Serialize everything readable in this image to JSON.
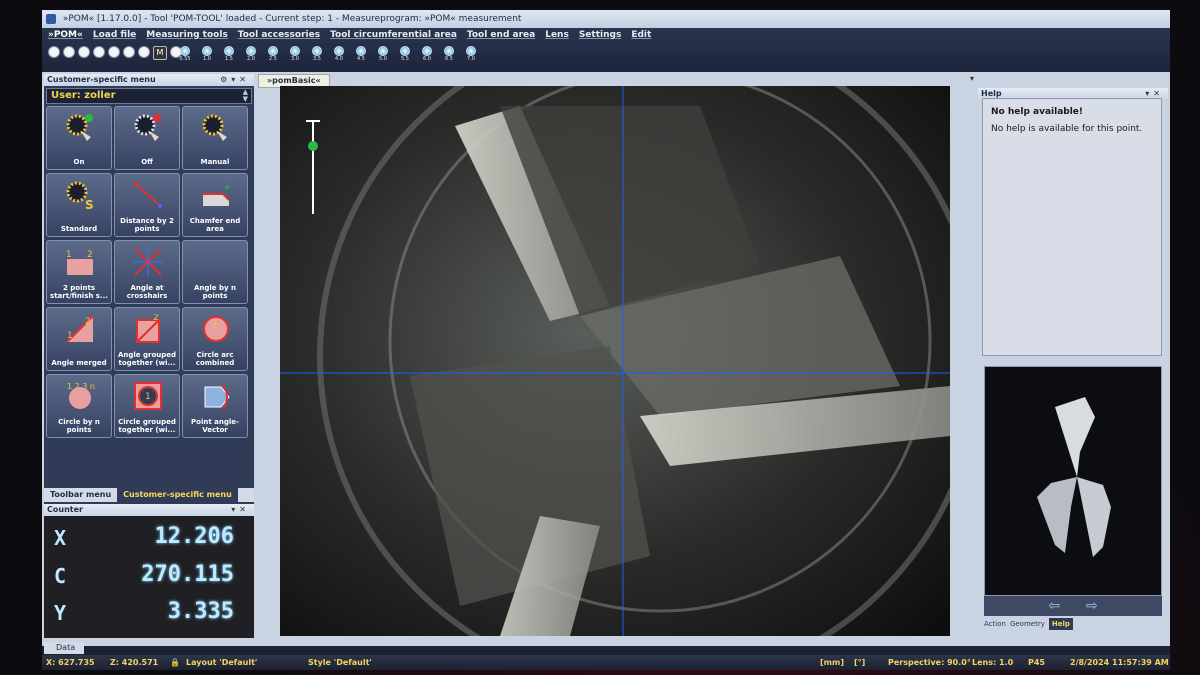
{
  "window": {
    "title": "»POM« [1.17.0.0] - Tool 'POM-TOOL' loaded - Current step: 1 - Measureprogram: »POM« measurement"
  },
  "menu": {
    "brand": "»POM«",
    "items": [
      "Load file",
      "Measuring tools",
      "Tool accessories",
      "Tool circumferential area",
      "Tool end area",
      "Lens",
      "Settings",
      "Edit"
    ]
  },
  "lenses": [
    "0.55",
    "1.0",
    "1.5",
    "2.0",
    "2.5",
    "3.0",
    "3.5",
    "4.0",
    "4.5",
    "5.0",
    "5.5",
    "6.0",
    "6.5",
    "7.0"
  ],
  "left_panel": {
    "title": "Customer-specific menu",
    "user": "User: zoller",
    "tiles": [
      {
        "label": "On"
      },
      {
        "label": "Off"
      },
      {
        "label": "Manual"
      },
      {
        "label": "Standard"
      },
      {
        "label": "Distance by 2 points"
      },
      {
        "label": "Chamfer end area"
      },
      {
        "label": "2 points start/finish s..."
      },
      {
        "label": "Angle at crosshairs"
      },
      {
        "label": "Angle by n points"
      },
      {
        "label": "Angle merged"
      },
      {
        "label": "Angle grouped together (wi..."
      },
      {
        "label": "Circle arc combined"
      },
      {
        "label": "Circle by n points"
      },
      {
        "label": "Circle grouped together (wi..."
      },
      {
        "label": "Point angle-Vector"
      }
    ],
    "tabs": [
      "Toolbar menu",
      "Customer-specific menu"
    ]
  },
  "counter": {
    "title": "Counter",
    "rows": [
      {
        "axis": "X",
        "value": "12.206"
      },
      {
        "axis": "C",
        "value": "270.115"
      },
      {
        "axis": "Y",
        "value": "3.335"
      }
    ]
  },
  "center": {
    "tab": "»pomBasic«"
  },
  "help_panel": {
    "title": "Help",
    "heading": "No help available!",
    "text": "No help is available for this point.",
    "nav_prev": "⇦",
    "nav_next": "⇨",
    "tabs": [
      "Action",
      "Geometry",
      "Help"
    ]
  },
  "data_tab": "Data",
  "status": {
    "x": "X: 627.735",
    "z": "Z: 420.571",
    "layout": "Layout 'Default'",
    "style": "Style 'Default'",
    "unit1": "[mm]",
    "unit2": "[°]",
    "perspective": "Perspective: 90.0°",
    "lens": "Lens: 1.0",
    "p45": "P45",
    "datetime": "2/8/2024 11:57:39 AM"
  },
  "colors": {
    "crosshair": "#1e5bff",
    "user_text": "#f0d850",
    "counter_text": "#bdeaff",
    "status_text": "#f2d45c",
    "live_dot": "#2fb84a",
    "off_dot": "#e03030"
  }
}
